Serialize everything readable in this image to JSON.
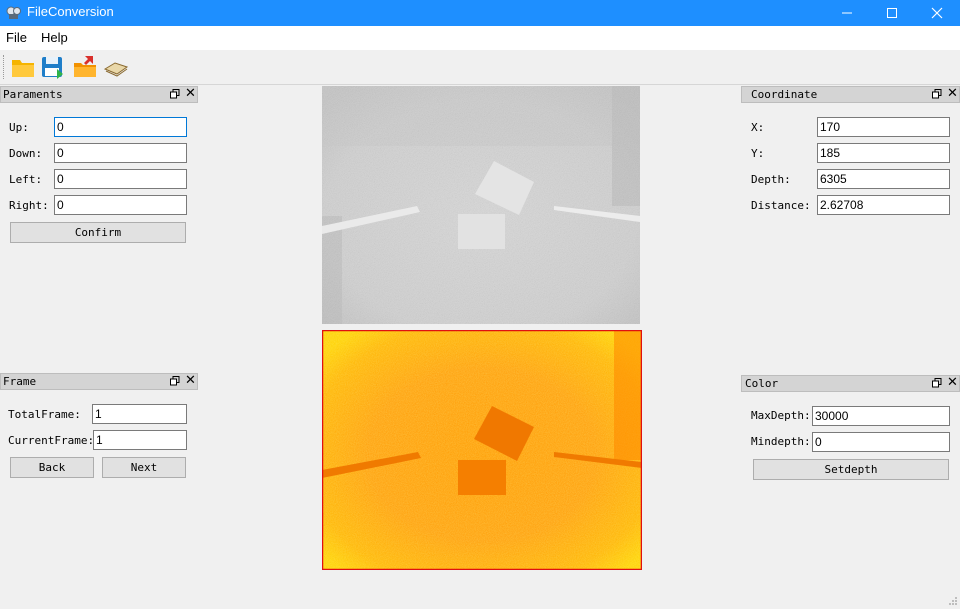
{
  "window": {
    "title": "FileConversion",
    "icon": "app-film-icon",
    "controls": [
      "minimize-icon",
      "maximize-icon",
      "close-icon"
    ],
    "accent": "#1e8fff"
  },
  "menu": {
    "items": [
      "File",
      "Help"
    ]
  },
  "toolbar": {
    "buttons": [
      "open-folder-icon",
      "save-icon",
      "export-icon",
      "book-icon"
    ]
  },
  "paraments": {
    "title": "Paraments",
    "fields": [
      {
        "label": "Up:",
        "value": "0"
      },
      {
        "label": "Down:",
        "value": "0"
      },
      {
        "label": "Left:",
        "value": "0"
      },
      {
        "label": "Right:",
        "value": "0"
      }
    ],
    "confirm": "Confirm"
  },
  "frame": {
    "title": "Frame",
    "total_label": "TotalFrame:",
    "total_value": "1",
    "current_label": "CurrentFrame:",
    "current_value": "1",
    "back": "Back",
    "next": "Next"
  },
  "coordinate": {
    "title": "Coordinate",
    "fields": [
      {
        "label": "X:",
        "value": "170"
      },
      {
        "label": "Y:",
        "value": "185"
      },
      {
        "label": "Depth:",
        "value": "6305"
      },
      {
        "label": "Distance:",
        "value": "2.62708"
      }
    ]
  },
  "color": {
    "title": "Color",
    "max_label": "MaxDepth:",
    "max_value": "30000",
    "min_label": "Mindepth:",
    "min_value": "0",
    "set": "Setdepth"
  }
}
